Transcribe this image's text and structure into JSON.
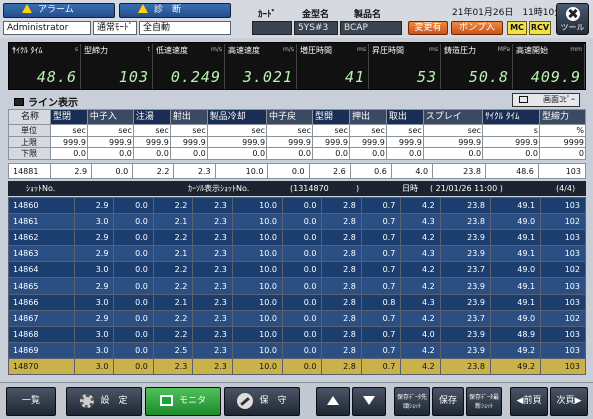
{
  "header": {
    "alarm_label": "アラーム",
    "diag_label": "診　断",
    "user": "Administrator",
    "mode": "通常ﾓｰﾄﾞ",
    "auto": "全自動",
    "card_label": "ｶｰﾄﾞ",
    "mold_label": "金型名",
    "product_label": "製品名",
    "mold_value": "5YS#3",
    "product_value": "BCAP",
    "datetime": "21年01月26日　11時10分",
    "change_btn": "変更有",
    "pump_btn": "ポンプ入",
    "mc_btn": "MC",
    "rcv_btn": "RCV",
    "tool_btn": "ツール"
  },
  "panel": [
    {
      "label": "ｻｲｸﾙ ﾀｲﾑ",
      "unit": "s",
      "value": "48.6"
    },
    {
      "label": "型締力",
      "unit": "t",
      "value": "103"
    },
    {
      "label": "低速速度",
      "unit": "m/s",
      "value": "0.249"
    },
    {
      "label": "高速速度",
      "unit": "m/s",
      "value": "3.021"
    },
    {
      "label": "増圧時間",
      "unit": "ms",
      "value": "41"
    },
    {
      "label": "昇圧時間",
      "unit": "ms",
      "value": "53"
    },
    {
      "label": "鋳造圧力",
      "unit": "MPa",
      "value": "50.8"
    },
    {
      "label": "高速開始",
      "unit": "mm",
      "value": "409.9"
    }
  ],
  "line": {
    "title": "ライン表示",
    "copy_btn": "画面ｺﾋﾟｰ",
    "name_label": "名称",
    "columns": [
      "型閉",
      "中子入",
      "注湯",
      "射出",
      "製品冷却",
      "中子戻",
      "型開",
      "押出",
      "取出",
      "スプレイ",
      "ｻｲｸﾙ ﾀｲﾑ",
      "型締力"
    ],
    "row_labels": [
      "単位",
      "上限",
      "下限"
    ],
    "units": [
      "sec",
      "sec",
      "sec",
      "sec",
      "sec",
      "sec",
      "sec",
      "sec",
      "sec",
      "sec",
      "s",
      "%"
    ],
    "upper": [
      "999.9",
      "999.9",
      "999.9",
      "999.9",
      "999.9",
      "999.9",
      "999.9",
      "999.9",
      "999.9",
      "999.9",
      "999.9",
      "9999"
    ],
    "lower": [
      "0.0",
      "0.0",
      "0.0",
      "0.0",
      "0.0",
      "0.0",
      "0.0",
      "0.0",
      "0.0",
      "0.0",
      "0.0",
      "0"
    ],
    "current": {
      "shot": "14881",
      "values": [
        "2.9",
        "0.0",
        "2.2",
        "2.3",
        "10.0",
        "0.0",
        "2.6",
        "0.6",
        "4.0",
        "23.8",
        "48.6",
        "103"
      ]
    }
  },
  "shotbar": {
    "shot_label": "ｼｮｯﾄNo.",
    "carousel_label": "ｶｰｿﾙ表示ｼｮｯﾄNo.",
    "carousel_value": "(1314870",
    "close_paren": ")",
    "datetime_label": "日時",
    "datetime_value": "( 21/01/26 11:00 )",
    "page": "(4/4)"
  },
  "history": [
    {
      "shot": "14860",
      "values": [
        "2.9",
        "0.0",
        "2.2",
        "2.3",
        "10.0",
        "0.0",
        "2.8",
        "0.7",
        "4.2",
        "23.8",
        "49.1",
        "103"
      ]
    },
    {
      "shot": "14861",
      "values": [
        "3.0",
        "0.0",
        "2.1",
        "2.3",
        "10.0",
        "0.0",
        "2.8",
        "0.7",
        "4.3",
        "23.8",
        "49.0",
        "102"
      ]
    },
    {
      "shot": "14862",
      "values": [
        "2.9",
        "0.0",
        "2.2",
        "2.3",
        "10.0",
        "0.0",
        "2.8",
        "0.7",
        "4.2",
        "23.9",
        "49.1",
        "103"
      ]
    },
    {
      "shot": "14863",
      "values": [
        "2.9",
        "0.0",
        "2.1",
        "2.3",
        "10.0",
        "0.0",
        "2.8",
        "0.7",
        "4.3",
        "23.9",
        "49.1",
        "103"
      ]
    },
    {
      "shot": "14864",
      "values": [
        "3.0",
        "0.0",
        "2.2",
        "2.3",
        "10.0",
        "0.0",
        "2.8",
        "0.7",
        "4.2",
        "23.7",
        "49.0",
        "102"
      ]
    },
    {
      "shot": "14865",
      "values": [
        "2.9",
        "0.0",
        "2.2",
        "2.3",
        "10.0",
        "0.0",
        "2.8",
        "0.7",
        "4.2",
        "23.9",
        "49.1",
        "103"
      ]
    },
    {
      "shot": "14866",
      "values": [
        "3.0",
        "0.0",
        "2.1",
        "2.3",
        "10.0",
        "0.0",
        "2.8",
        "0.8",
        "4.3",
        "23.9",
        "49.1",
        "103"
      ]
    },
    {
      "shot": "14867",
      "values": [
        "2.9",
        "0.0",
        "2.2",
        "2.3",
        "10.0",
        "0.0",
        "2.8",
        "0.7",
        "4.2",
        "23.7",
        "49.0",
        "102"
      ]
    },
    {
      "shot": "14868",
      "values": [
        "3.0",
        "0.0",
        "2.2",
        "2.3",
        "10.0",
        "0.0",
        "2.8",
        "0.7",
        "4.0",
        "23.9",
        "48.9",
        "103"
      ]
    },
    {
      "shot": "14869",
      "values": [
        "3.0",
        "0.0",
        "2.5",
        "2.3",
        "10.0",
        "0.0",
        "2.8",
        "0.7",
        "4.2",
        "23.9",
        "49.2",
        "103"
      ]
    },
    {
      "shot": "14870",
      "values": [
        "3.0",
        "0.0",
        "2.3",
        "2.3",
        "10.0",
        "0.0",
        "2.8",
        "0.7",
        "4.2",
        "23.8",
        "49.2",
        "103"
      ]
    }
  ],
  "footer": {
    "list_btn": "一覧",
    "settings_btn": "設　定",
    "monitor_btn": "モニタ",
    "maint_btn": "保　守",
    "save_btn": "保存",
    "save_first_btn": "保存ﾃﾞｰﾀ先頭ｼｮｯﾄ",
    "save_last_btn": "保存ﾃﾞｰﾀ最新ｼｮｯﾄ",
    "prev_btn": "前頁",
    "next_btn": "次頁"
  },
  "colors": {
    "header_blue": "#1a2d55",
    "row_odd": "#1b3e6e",
    "row_even": "#2b4f82",
    "highlight": "#c9b24a",
    "digit_green": "#b8f3b0",
    "active_green": "#1e8a2c",
    "orange": "#e0641f"
  }
}
